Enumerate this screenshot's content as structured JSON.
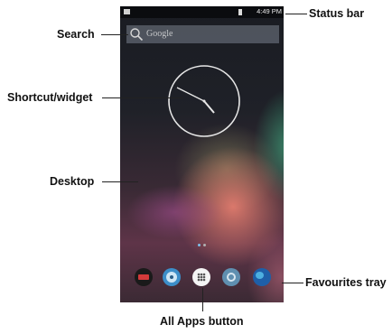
{
  "callouts": {
    "status_bar": "Status bar",
    "search": "Search",
    "shortcut_widget": "Shortcut/widget",
    "desktop": "Desktop",
    "favourites_tray": "Favourites tray",
    "all_apps_button": "All Apps button"
  },
  "phone": {
    "status_time": "4:49 PM",
    "search_placeholder": "Google",
    "clock_time": "4:49"
  },
  "colors": {
    "line": "#222222",
    "accent_blue": "#1e7fd0"
  },
  "icons": [
    "notification-icon",
    "battery-icon",
    "search-icon",
    "analog-clock",
    "page-indicator-dots",
    "app-icon-red",
    "app-icon-disc",
    "all-apps-icon",
    "settings-gear-icon",
    "globe-icon"
  ]
}
